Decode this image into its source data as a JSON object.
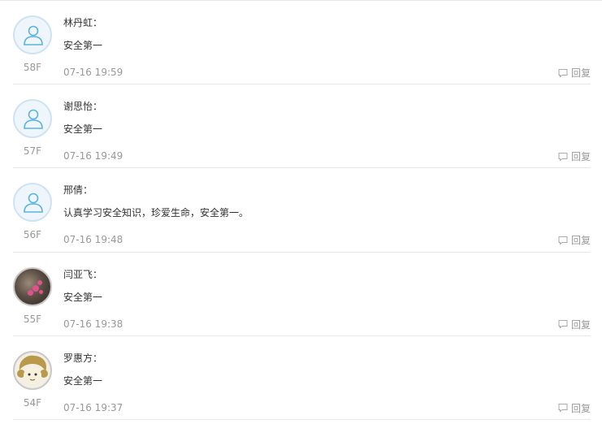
{
  "comments": [
    {
      "author": "林丹虹：",
      "content": "安全第一",
      "time": "07-16 19:59",
      "floor": "58F",
      "reply": "回复",
      "avatar": "default"
    },
    {
      "author": "谢思怡：",
      "content": "安全第一",
      "time": "07-16 19:49",
      "floor": "57F",
      "reply": "回复",
      "avatar": "default"
    },
    {
      "author": "邢倩：",
      "content": "认真学习安全知识，珍爱生命，安全第一。",
      "time": "07-16 19:48",
      "floor": "56F",
      "reply": "回复",
      "avatar": "default"
    },
    {
      "author": "闫亚飞：",
      "content": "安全第一",
      "time": "07-16 19:38",
      "floor": "55F",
      "reply": "回复",
      "avatar": "photo-flowers"
    },
    {
      "author": "罗惠方：",
      "content": "安全第一",
      "time": "07-16 19:37",
      "floor": "54F",
      "reply": "回复",
      "avatar": "photo-cartoon"
    }
  ],
  "colors": {
    "muted": "#999999",
    "text": "#333333",
    "avatar_outline": "#5ab4e0",
    "divider": "#e8e8e8"
  }
}
